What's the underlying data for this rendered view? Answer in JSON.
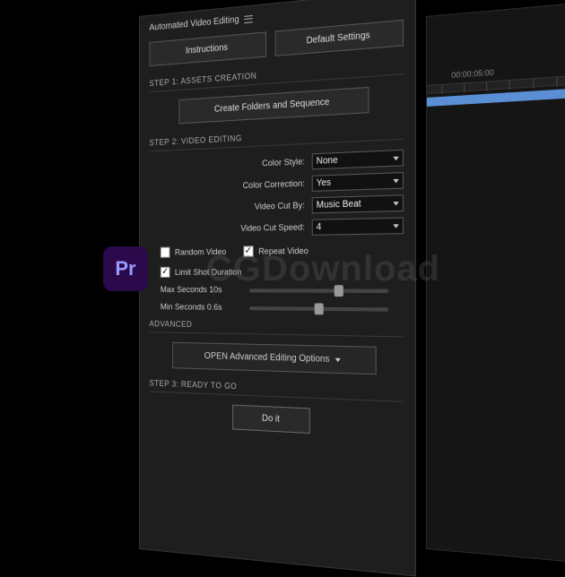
{
  "panel_title": "Automated Video Editing",
  "top_buttons": {
    "instructions": "Instructions",
    "defaults": "Default Settings"
  },
  "step1": {
    "label": "STEP 1: ASSETS CREATION",
    "button": "Create Folders and Sequence"
  },
  "step2": {
    "label": "STEP 2: VIDEO EDITING",
    "color_style": {
      "label": "Color Style:",
      "value": "None"
    },
    "color_correction": {
      "label": "Color Correction:",
      "value": "Yes"
    },
    "cut_by": {
      "label": "Video Cut By:",
      "value": "Music Beat"
    },
    "cut_speed": {
      "label": "Video Cut Speed:",
      "value": "4"
    },
    "random_video": {
      "label": "Random Video",
      "checked": false
    },
    "repeat_video": {
      "label": "Repeat Video",
      "checked": true
    },
    "limit_shot": {
      "label": "Limit Shot Duration",
      "checked": true
    },
    "max_seconds": {
      "label": "Max Seconds 10s",
      "pos": 62
    },
    "min_seconds": {
      "label": "Min Seconds 0.6s",
      "pos": 48
    }
  },
  "advanced": {
    "label": "ADVANCED",
    "button": "OPEN Advanced Editing Options"
  },
  "step3": {
    "label": "STEP 3: READY TO GO",
    "button": "Do it"
  },
  "timeline": {
    "timecode": "00:00:05:00"
  },
  "badge": "Pr",
  "watermark": "CGDownload"
}
